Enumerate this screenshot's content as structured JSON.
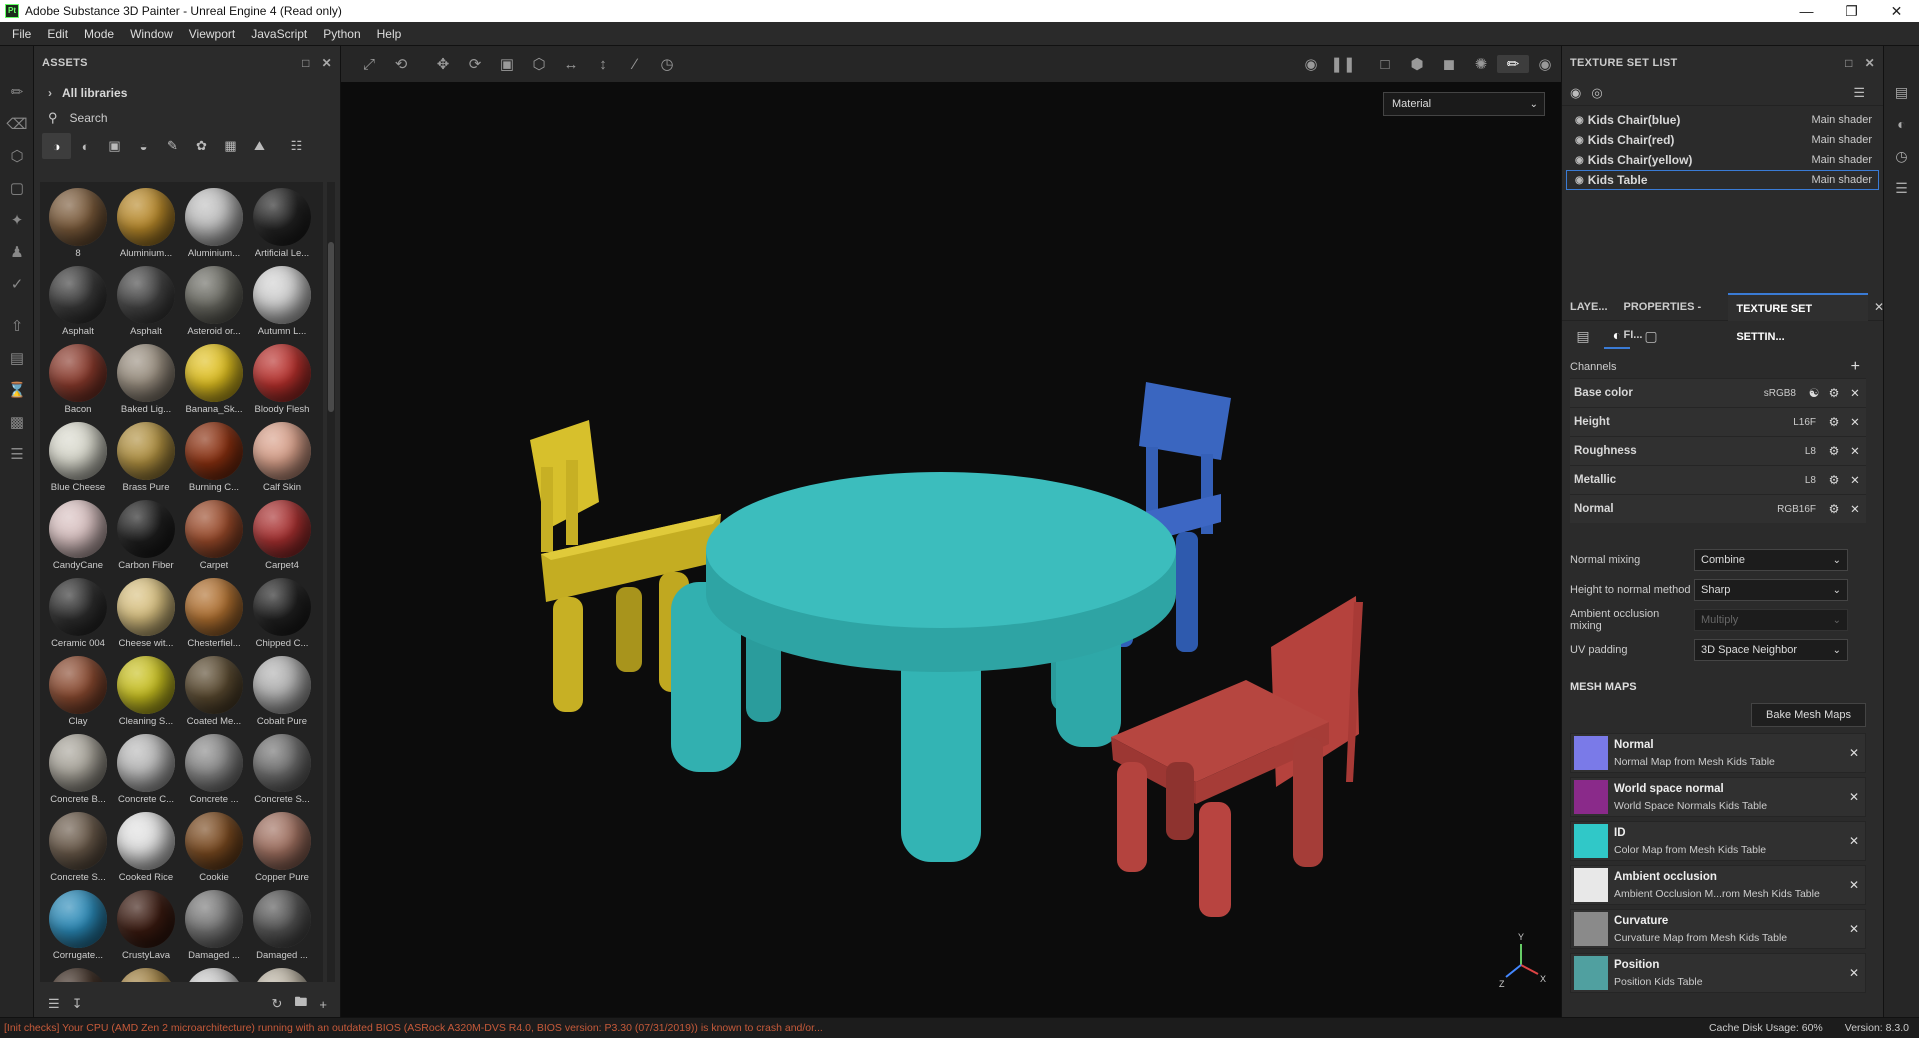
{
  "window": {
    "title": "Adobe Substance 3D Painter - Unreal Engine 4 (Read only)",
    "app_icon": "Pt"
  },
  "menu": [
    "File",
    "Edit",
    "Mode",
    "Window",
    "Viewport",
    "JavaScript",
    "Python",
    "Help"
  ],
  "assets": {
    "title": "ASSETS",
    "libraries": "All libraries",
    "search_placeholder": "Search",
    "items": [
      {
        "label": "8",
        "color": "#7a5a3a"
      },
      {
        "label": "Aluminium...",
        "color": "#b8892a"
      },
      {
        "label": "Aluminium...",
        "color": "#bfbfbf"
      },
      {
        "label": "Artificial Le...",
        "color": "#222"
      },
      {
        "label": "Asphalt",
        "color": "#3a3a3a"
      },
      {
        "label": "Asphalt",
        "color": "#444"
      },
      {
        "label": "Asteroid or...",
        "color": "#6a6a62"
      },
      {
        "label": "Autumn L...",
        "color": "#d0d0d0"
      },
      {
        "label": "Bacon",
        "color": "#8a3a2c"
      },
      {
        "label": "Baked Lig...",
        "color": "#9a8f80"
      },
      {
        "label": "Banana_Sk...",
        "color": "#e0c020"
      },
      {
        "label": "Bloody Flesh",
        "color": "#b8302c"
      },
      {
        "label": "Blue Cheese",
        "color": "#d8d8cc"
      },
      {
        "label": "Brass Pure",
        "color": "#b09040"
      },
      {
        "label": "Burning C...",
        "color": "#8a3010"
      },
      {
        "label": "Calf Skin",
        "color": "#d8a08a"
      },
      {
        "label": "CandyCane",
        "color": "#d8c0c0"
      },
      {
        "label": "Carbon Fiber",
        "color": "#1e1e1e"
      },
      {
        "label": "Carpet",
        "color": "#9a4a2a"
      },
      {
        "label": "Carpet4",
        "color": "#a83030"
      },
      {
        "label": "Ceramic 004",
        "color": "#2e2e2e"
      },
      {
        "label": "Cheese wit...",
        "color": "#d8c080"
      },
      {
        "label": "Chesterfiel...",
        "color": "#b07030"
      },
      {
        "label": "Chipped C...",
        "color": "#202020"
      },
      {
        "label": "Clay",
        "color": "#8a4a30"
      },
      {
        "label": "Cleaning S...",
        "color": "#c8c020"
      },
      {
        "label": "Coated Me...",
        "color": "#5a4a30"
      },
      {
        "label": "Cobalt Pure",
        "color": "#b0b0b0"
      },
      {
        "label": "Concrete B...",
        "color": "#a8a49a"
      },
      {
        "label": "Concrete C...",
        "color": "#b8b8b8"
      },
      {
        "label": "Concrete ...",
        "color": "#888"
      },
      {
        "label": "Concrete S...",
        "color": "#707070"
      },
      {
        "label": "Concrete S...",
        "color": "#6a5a4a"
      },
      {
        "label": "Cooked Rice",
        "color": "#e0e0e0"
      },
      {
        "label": "Cookie",
        "color": "#7a4a20"
      },
      {
        "label": "Copper Pure",
        "color": "#a07060"
      },
      {
        "label": "Corrugate...",
        "color": "#2a8ab8"
      },
      {
        "label": "CrustyLava",
        "color": "#3a1a10"
      },
      {
        "label": "Damaged ...",
        "color": "#777"
      },
      {
        "label": "Damaged ...",
        "color": "#555"
      },
      {
        "label": "",
        "color": "#3a2a20"
      },
      {
        "label": "",
        "color": "#a08040"
      },
      {
        "label": "",
        "color": "#c8c8c8"
      },
      {
        "label": "",
        "color": "#b8b0a0"
      }
    ]
  },
  "viewport": {
    "material_mode": "Material",
    "axis_labels": {
      "y": "Y",
      "z": "Z",
      "x": "X"
    }
  },
  "texture_set_list": {
    "title": "TEXTURE SET LIST",
    "sets": [
      {
        "name": "Kids Chair(blue)",
        "shader": "Main shader"
      },
      {
        "name": "Kids Chair(red)",
        "shader": "Main shader"
      },
      {
        "name": "Kids Chair(yellow)",
        "shader": "Main shader"
      },
      {
        "name": "Kids Table",
        "shader": "Main shader"
      }
    ]
  },
  "tabs": {
    "layers": "LAYE...",
    "properties": "PROPERTIES - FI...",
    "texture_set_settings": "TEXTURE SET SETTIN..."
  },
  "settings": {
    "channels_label": "Channels",
    "channels": [
      {
        "name": "Base color",
        "format": "sRGB8"
      },
      {
        "name": "Height",
        "format": "L16F"
      },
      {
        "name": "Roughness",
        "format": "L8"
      },
      {
        "name": "Metallic",
        "format": "L8"
      },
      {
        "name": "Normal",
        "format": "RGB16F"
      }
    ],
    "props": [
      {
        "label": "Normal mixing",
        "value": "Combine"
      },
      {
        "label": "Height to normal method",
        "value": "Sharp"
      },
      {
        "label": "Ambient occlusion mixing",
        "value": "Multiply"
      },
      {
        "label": "UV padding",
        "value": "3D Space Neighbor"
      }
    ],
    "mesh_maps_label": "MESH MAPS",
    "bake_label": "Bake Mesh Maps",
    "mesh_maps": [
      {
        "title": "Normal",
        "sub": "Normal Map from Mesh Kids Table",
        "color": "#7a7ae8"
      },
      {
        "title": "World space normal",
        "sub": "World Space Normals Kids Table",
        "color": "#8a2a8a"
      },
      {
        "title": "ID",
        "sub": "Color Map from Mesh Kids Table",
        "color": "#30c8c8"
      },
      {
        "title": "Ambient occlusion",
        "sub": "Ambient Occlusion M...rom Mesh Kids Table",
        "color": "#e8e8e8"
      },
      {
        "title": "Curvature",
        "sub": "Curvature Map from Mesh Kids Table",
        "color": "#8a8a8a"
      },
      {
        "title": "Position",
        "sub": "Position Kids Table",
        "color": "#50a0a0"
      }
    ]
  },
  "status": {
    "warning": "[Init checks] Your CPU (AMD Zen 2 microarchitecture) running with an outdated BIOS (ASRock A320M-DVS R4.0, BIOS version: P3.30 (07/31/2019)) is known to crash and/or...",
    "cache": "Cache Disk Usage:   60%",
    "version": "Version: 8.3.0"
  }
}
